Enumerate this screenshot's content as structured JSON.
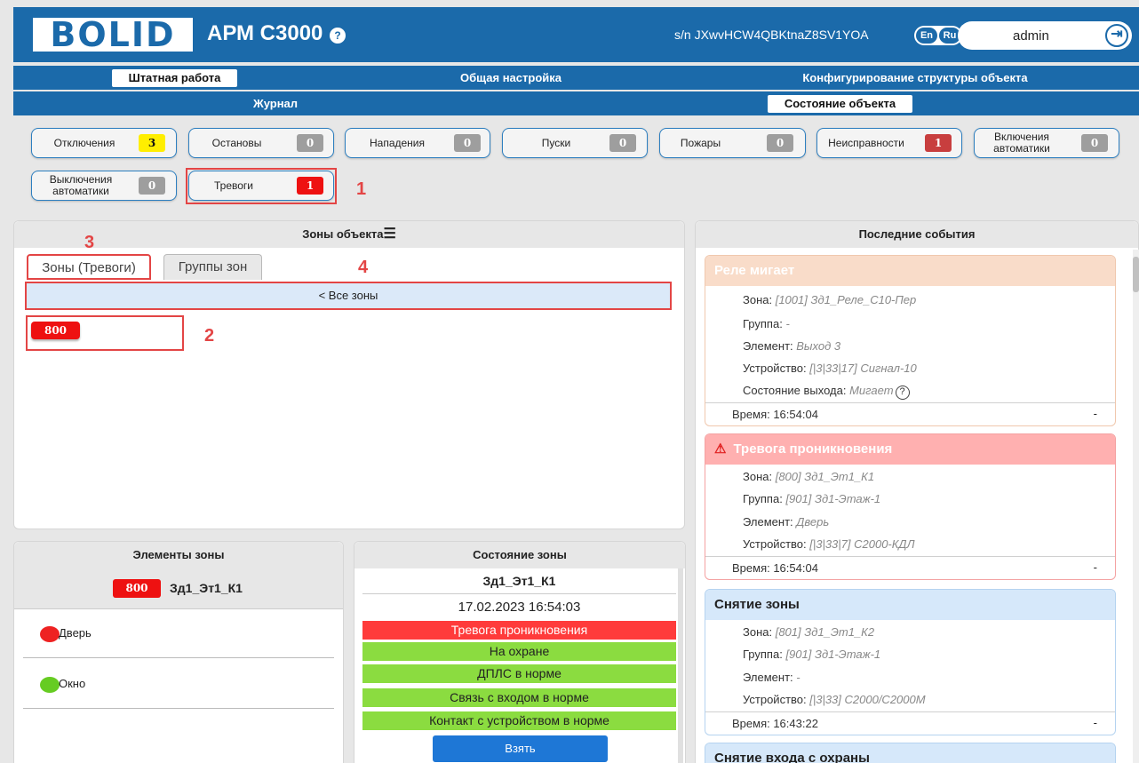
{
  "header": {
    "logo": "BOLID",
    "title": "АРМ С3000",
    "help_glyph": "?",
    "serial": "s/n JXwvHCW4QBKtnaZ8SV1YOA",
    "lang_en": "En",
    "lang_ru": "Ru",
    "user": "admin",
    "logout_glyph": "⇥"
  },
  "nav": {
    "row1": [
      "Штатная работа",
      "Общая настройка",
      "Конфигурирование структуры объекта"
    ],
    "row2": [
      "Журнал",
      "Состояние объекта"
    ]
  },
  "counters": [
    {
      "label": "Отключения",
      "value": "3"
    },
    {
      "label": "Остановы",
      "value": "0"
    },
    {
      "label": "Нападения",
      "value": "0"
    },
    {
      "label": "Пуски",
      "value": "0"
    },
    {
      "label": "Пожары",
      "value": "0"
    },
    {
      "label": "Неисправности",
      "value": "1"
    },
    {
      "label": "Включения автоматики",
      "value": "0"
    },
    {
      "label": "Выключения автоматики",
      "value": "0"
    },
    {
      "label": "Тревоги",
      "value": "1"
    }
  ],
  "annotations": [
    "1",
    "2",
    "3",
    "4"
  ],
  "zones_panel": {
    "title": "Зоны объекта",
    "menu_glyph": "☰",
    "tabs": [
      "Зоны (Тревоги)",
      "Группы зон"
    ],
    "all_zones": "< Все зоны",
    "zones": [
      "800"
    ]
  },
  "elements_panel": {
    "title": "Элементы зоны",
    "zone_num": "800",
    "zone_name": "Зд1_Эт1_К1",
    "items": [
      {
        "label": "Дверь",
        "color": "#ee2222"
      },
      {
        "label": "Окно",
        "color": "#66cc22"
      }
    ]
  },
  "state_panel": {
    "title": "Состояние зоны",
    "zone_name": "Зд1_Эт1_К1",
    "datetime": "17.02.2023 16:54:03",
    "states": [
      {
        "label": "Тревога проникновения",
        "kind": "red"
      },
      {
        "label": "На охране",
        "kind": "green"
      },
      {
        "label": "ДПЛС в норме",
        "kind": "green"
      },
      {
        "label": "Связь с входом в норме",
        "kind": "green"
      },
      {
        "label": "Контакт с устройством в норме",
        "kind": "green"
      }
    ],
    "take_button": "Взять"
  },
  "events_panel": {
    "title": "Последние события",
    "events": [
      {
        "title": "Реле мигает",
        "head_color": "#f9dcc9",
        "lines": [
          {
            "k": "Зона: ",
            "v": "[1001] Зд1_Реле_С10-Пер"
          },
          {
            "k": "Группа: ",
            "v": "-"
          },
          {
            "k": "Элемент: ",
            "v": "Выход 3"
          },
          {
            "k": "Устройство: ",
            "v": "[|3|33|17] Сигнал-10"
          },
          {
            "k": "Состояние выхода: ",
            "v": "Мигает"
          }
        ],
        "time": "Время: 16:54:04",
        "dash": "-"
      },
      {
        "title": "Тревога проникновения",
        "warn_glyph": "⚠",
        "head_color": "#ffb0b0",
        "lines": [
          {
            "k": "Зона: ",
            "v": "[800] Зд1_Эт1_К1"
          },
          {
            "k": "Группа: ",
            "v": "[901] Зд1-Этаж-1"
          },
          {
            "k": "Элемент: ",
            "v": "Дверь"
          },
          {
            "k": "Устройство: ",
            "v": "[|3|33|7] С2000-КДЛ"
          }
        ],
        "time": "Время: 16:54:04",
        "dash": "-"
      },
      {
        "title": "Снятие зоны",
        "head_color": "#d6e8fa",
        "lines": [
          {
            "k": "Зона: ",
            "v": "[801] Зд1_Эт1_К2"
          },
          {
            "k": "Группа: ",
            "v": "[901] Зд1-Этаж-1"
          },
          {
            "k": "Элемент: ",
            "v": "-"
          },
          {
            "k": "Устройство: ",
            "v": "[|3|33] С2000/С2000М"
          }
        ],
        "time": "Время: 16:43:22",
        "dash": "-"
      },
      {
        "title": "Снятие входа с охраны",
        "head_color": "#d6e8fa"
      }
    ]
  }
}
